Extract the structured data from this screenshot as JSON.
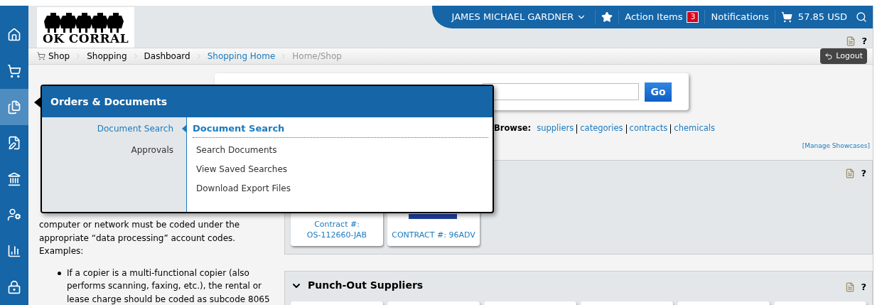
{
  "sidebar": {
    "items": [
      {
        "kind": "home",
        "selected": false
      },
      {
        "kind": "cart",
        "selected": false
      },
      {
        "kind": "documents",
        "selected": true
      },
      {
        "kind": "edit",
        "selected": false
      },
      {
        "kind": "bank",
        "selected": false
      },
      {
        "kind": "user",
        "selected": false
      },
      {
        "kind": "chart",
        "selected": false
      },
      {
        "kind": "lock",
        "selected": false
      }
    ]
  },
  "logo": {
    "text": "OK CORRAL"
  },
  "user_bar": {
    "user": "JAMES MICHAEL GARDNER",
    "action_items": "Action Items",
    "action_count": "3",
    "notifications": "Notifications",
    "cart_total": "57.85 USD"
  },
  "breadcrumbs": [
    {
      "label": "Shop",
      "kind": "plain"
    },
    {
      "label": "Shopping",
      "kind": "plain"
    },
    {
      "label": "Dashboard",
      "kind": "plain"
    },
    {
      "label": "Shopping Home",
      "kind": "link"
    },
    {
      "label": "Home/Shop",
      "kind": "current"
    }
  ],
  "logout": "Logout",
  "search": {
    "button": "Go"
  },
  "browse": {
    "label": "Browse:",
    "links": [
      "suppliers",
      "categories",
      "contracts",
      "chemicals"
    ]
  },
  "manage_showcases": "[Manage Showcases]",
  "showcase": {
    "help": "?",
    "cards": [
      {
        "lines": [
          "Contract #:",
          "OS-112660-JAB"
        ],
        "image": false
      },
      {
        "lines": [
          "CONTRACT #: 96ADV"
        ],
        "image": true
      }
    ]
  },
  "punchout": {
    "title": "Punch-Out Suppliers",
    "help": "?"
  },
  "header_help": "?",
  "left_text": {
    "paragraph": "computer or network must be coded under the appropriate “data processing” account codes. Examples:",
    "bullets": [
      "If a copier is a multi-functional copier (also performs scanning, faxing, etc.), the rental or lease charge should be coded as subcode 8065"
    ]
  },
  "flyout": {
    "title": "Orders & Documents",
    "categories": [
      {
        "label": "Document Search",
        "selected": true
      },
      {
        "label": "Approvals",
        "selected": false
      }
    ],
    "section_title": "Document Search",
    "links": [
      "Search Documents",
      "View Saved Searches",
      "Download Export Files"
    ]
  }
}
